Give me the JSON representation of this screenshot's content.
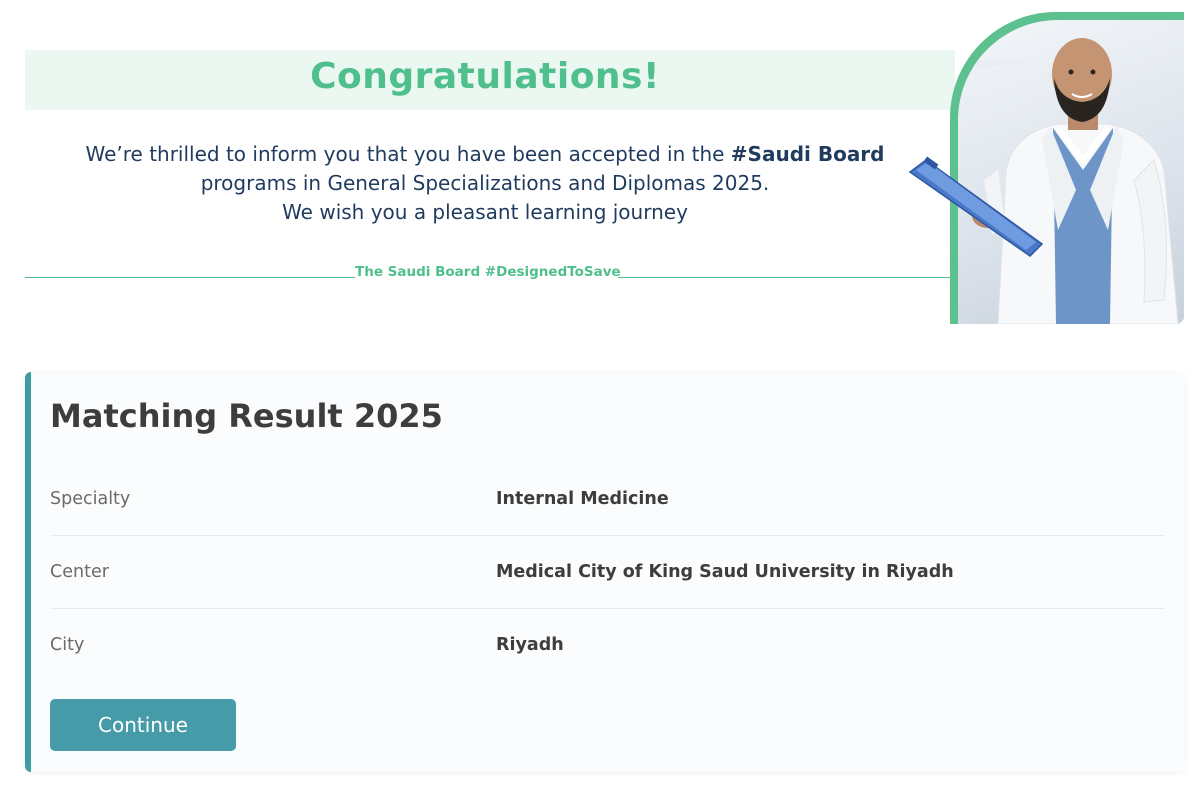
{
  "hero": {
    "title": "Congratulations!",
    "message_line1_prefix": "We’re thrilled to inform you that you have been accepted in the ",
    "message_line1_hashtag": "#Saudi Board",
    "message_line2": "programs in General Specializations and Diplomas 2025.",
    "message_line3": "We wish you a pleasant learning journey",
    "tagline": "The Saudi Board #DesignedToSave"
  },
  "result_card": {
    "title": "Matching Result 2025",
    "rows": [
      {
        "label": "Specialty",
        "value": "Internal Medicine"
      },
      {
        "label": "Center",
        "value": "Medical City of King Saud University in Riyadh"
      },
      {
        "label": "City",
        "value": "Riyadh"
      }
    ],
    "continue_label": "Continue"
  },
  "colors": {
    "accent_green": "#4fc08d",
    "hero_band": "#ebf8f1",
    "text_navy": "#1f3b5e",
    "card_accent": "#3f9aa5",
    "button": "#459ca8"
  }
}
